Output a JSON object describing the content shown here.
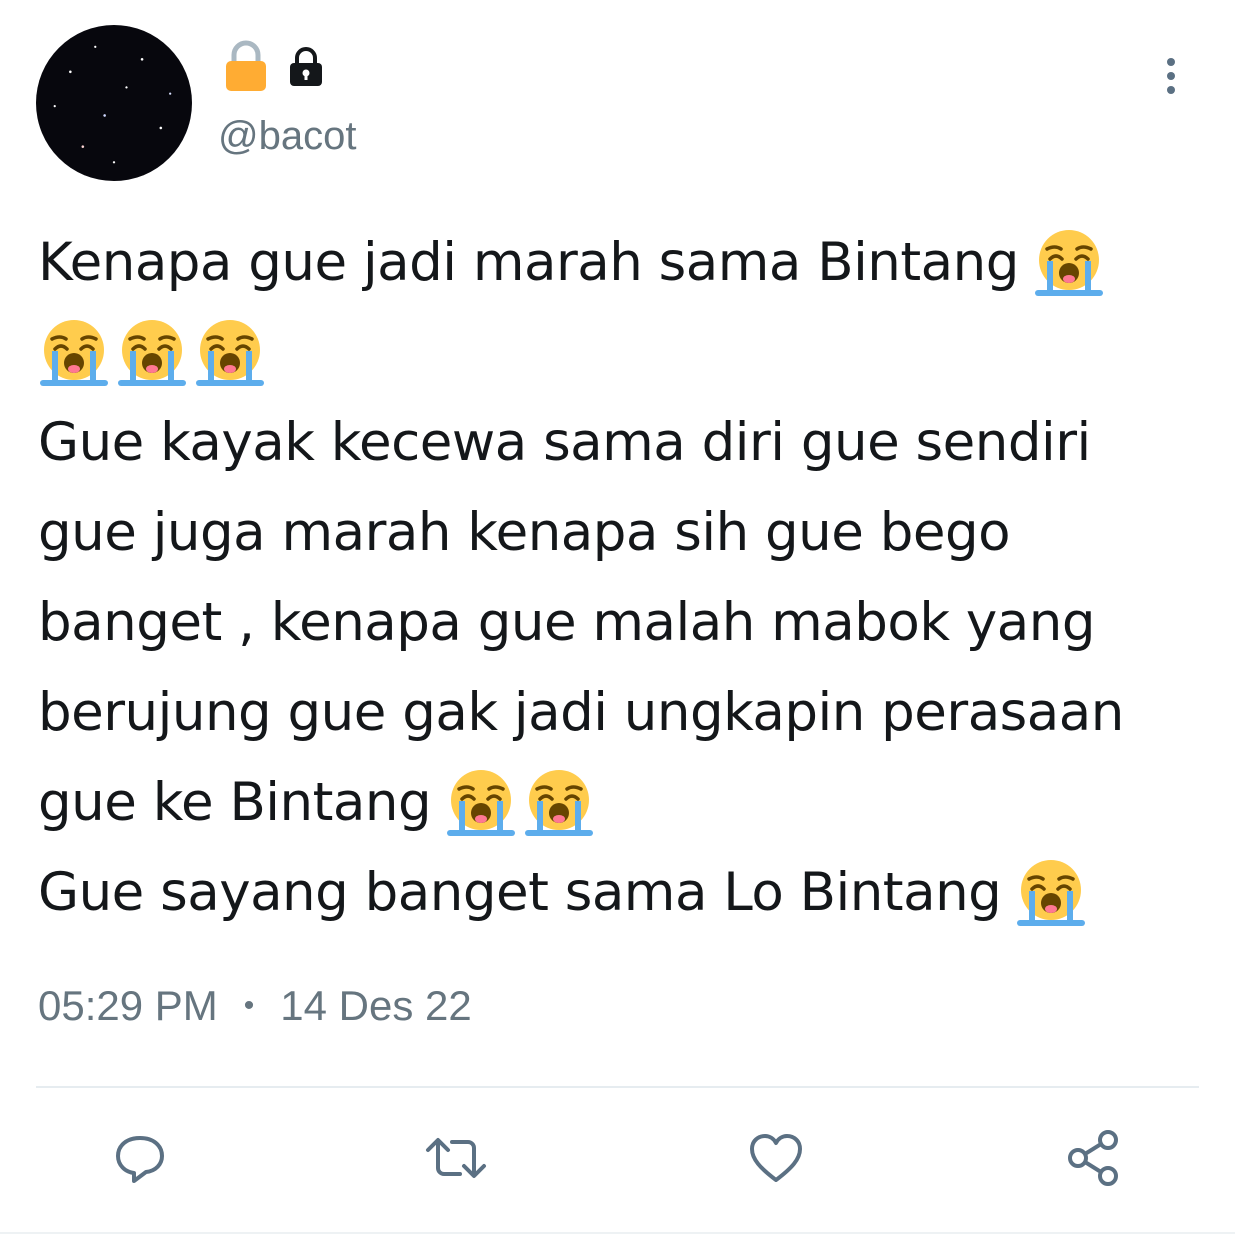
{
  "tweet": {
    "handle": "@bacot",
    "name_icons": [
      "lock-icon-yellow",
      "lock-icon-black"
    ],
    "text_lines": [
      {
        "text": "Kenapa gue jadi marah sama Bintang",
        "emoji_count": 1
      },
      {
        "text": "",
        "emoji_count": 3
      },
      {
        "text": "Gue kayak kecewa sama diri gue sendiri",
        "emoji_count": 0
      },
      {
        "text": "gue juga marah kenapa sih gue bego",
        "emoji_count": 0
      },
      {
        "text": "banget , kenapa gue malah mabok yang",
        "emoji_count": 0
      },
      {
        "text": "berujung gue gak jadi ungkapin perasaan",
        "emoji_count": 0
      },
      {
        "text": "gue ke Bintang",
        "emoji_count": 2
      },
      {
        "text": "Gue sayang banget sama Lo Bintang",
        "emoji_count": 1
      }
    ],
    "emoji_name": "loudly-crying-face",
    "time": "05:29 PM",
    "date": "14 Des 22"
  },
  "actions": [
    "reply-icon",
    "retweet-icon",
    "like-icon",
    "share-icon"
  ],
  "colors": {
    "text": "#14171a",
    "muted": "#66757f",
    "icon": "#5b7083",
    "lock_yellow": "#ffac33",
    "divider": "#e6ecf0"
  }
}
